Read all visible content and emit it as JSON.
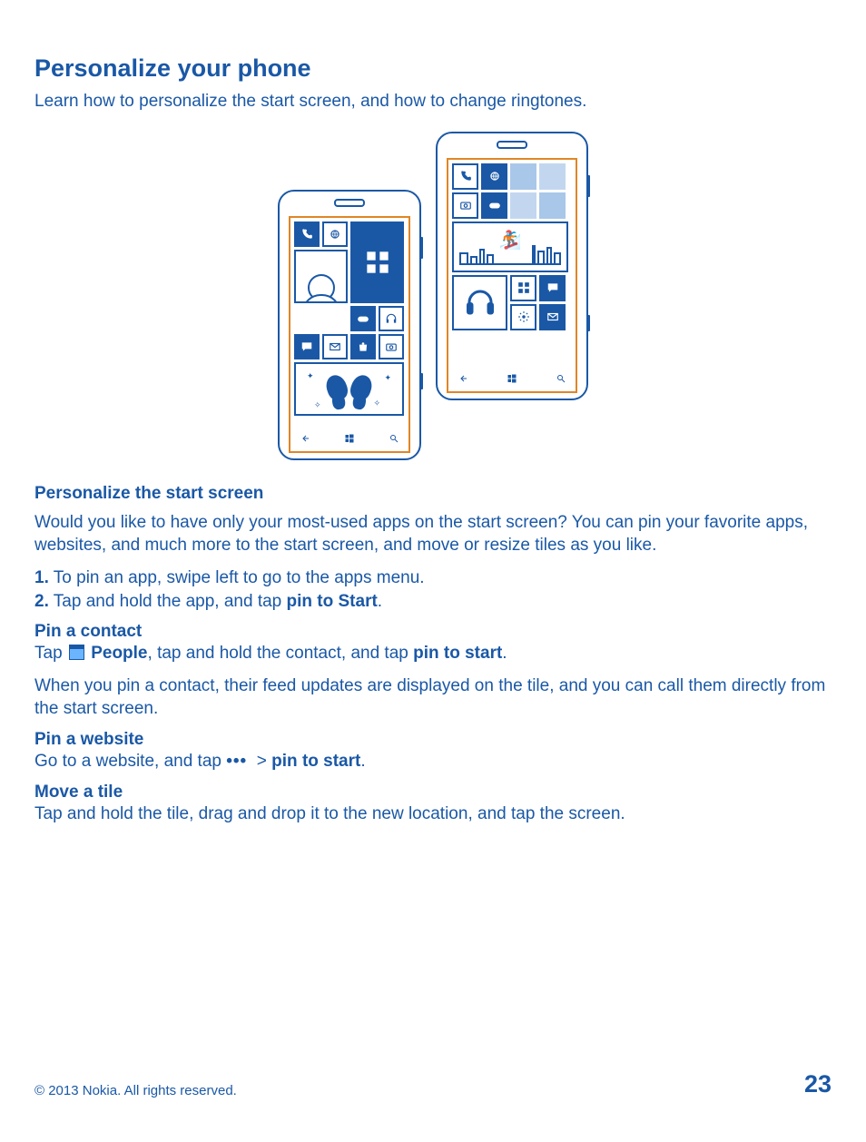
{
  "heading": "Personalize your phone",
  "intro": "Learn how to personalize the start screen, and how to change ringtones.",
  "section_personalize": {
    "title": "Personalize the start screen",
    "body": "Would you like to have only your most-used apps on the start screen? You can pin your favorite apps, websites, and much more to the start screen, and move or resize tiles as you like.",
    "step1_num": "1.",
    "step1_text": " To pin an app, swipe left to go to the apps menu.",
    "step2_num": "2.",
    "step2_text_a": " Tap and hold the app, and tap ",
    "step2_text_b": "pin to Start",
    "step2_text_c": "."
  },
  "pin_contact": {
    "title": "Pin a contact",
    "line_a": "Tap ",
    "line_icon_label": "People",
    "line_b": ", tap and hold the contact, and tap ",
    "line_c": "pin to start",
    "line_d": ".",
    "followup": "When you pin a contact, their feed updates are displayed on the tile, and you can call them directly from the start screen."
  },
  "pin_website": {
    "title": "Pin a website",
    "line_a": "Go to a website, and tap ",
    "dots": "•••",
    "gt": ">",
    "line_b": "pin to start",
    "line_c": "."
  },
  "move_tile": {
    "title": "Move a tile",
    "body": "Tap and hold the tile, drag and drop it to the new location, and tap the screen."
  },
  "footer": {
    "copyright": "© 2013 Nokia. All rights reserved.",
    "page": "23"
  },
  "illustration": {
    "phone1_icons": [
      "phone",
      "ie",
      "apps",
      "profile",
      "game",
      "headphones",
      "chat",
      "mail",
      "store",
      "camera",
      "butterfly"
    ],
    "phone2_icons": [
      "phone",
      "ie",
      "camera",
      "game",
      "skater",
      "headphones",
      "apps",
      "chat",
      "settings",
      "mail"
    ],
    "nav_icons": [
      "back",
      "windows",
      "search"
    ]
  }
}
